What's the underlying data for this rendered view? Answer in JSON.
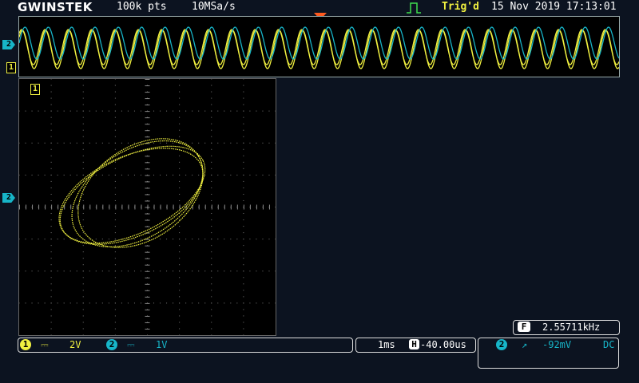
{
  "header": {
    "brand": "GWINSTEK",
    "record_length": "100k pts",
    "sample_rate": "10MSa/s",
    "trigger_status": "Trig'd",
    "datetime": "15 Nov 2019 17:13:01"
  },
  "markers": {
    "ch1": "1",
    "ch2": "2"
  },
  "channel_bar": {
    "ch1_num": "1",
    "ch1_coupling": "⎓",
    "ch1_scale": "2V",
    "ch2_num": "2",
    "ch2_coupling": "⎓",
    "ch2_scale": "1V"
  },
  "timebase": {
    "scale": "1ms",
    "pos_label": "H",
    "position": "-40.00us"
  },
  "trigger": {
    "source": "2",
    "slope": "↗",
    "level": "-92mV",
    "coupling": "DC"
  },
  "frequency": {
    "label": "F",
    "value": "2.55711kHz"
  },
  "colors": {
    "ch1": "#f0f040",
    "ch2": "#17b5c8",
    "background": "#0c1320"
  }
}
